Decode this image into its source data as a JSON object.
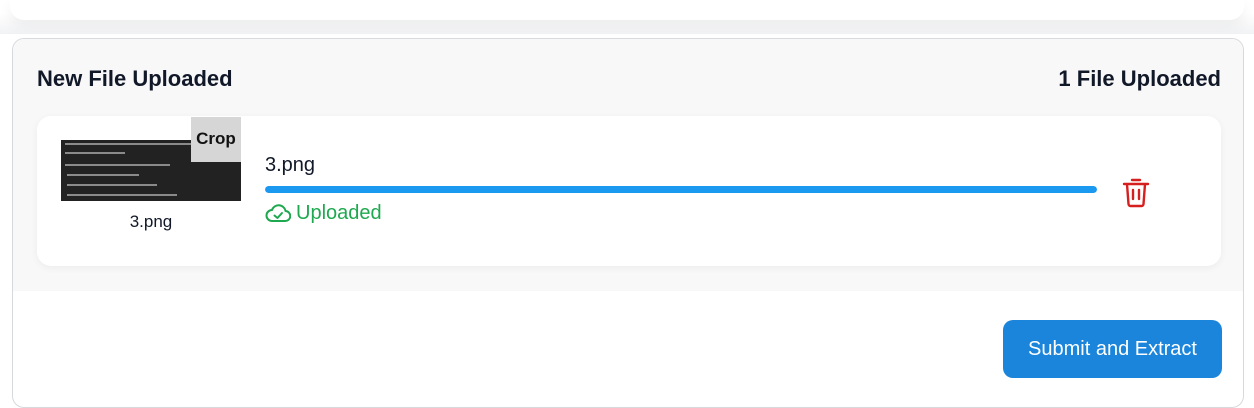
{
  "panel": {
    "title": "New File Uploaded",
    "count_label": "1 File Uploaded"
  },
  "file": {
    "thumbnail_name": "3.png",
    "name": "3.png",
    "crop_label": "Crop",
    "progress_percent": 100,
    "status_label": "Uploaded",
    "status_icon": "cloud-check-icon",
    "delete_icon": "trash-icon"
  },
  "actions": {
    "submit_label": "Submit and Extract"
  },
  "colors": {
    "progress": "#1b98f0",
    "status": "#1ea84f",
    "delete": "#d61f1f",
    "submit_bg": "#1a85db"
  }
}
